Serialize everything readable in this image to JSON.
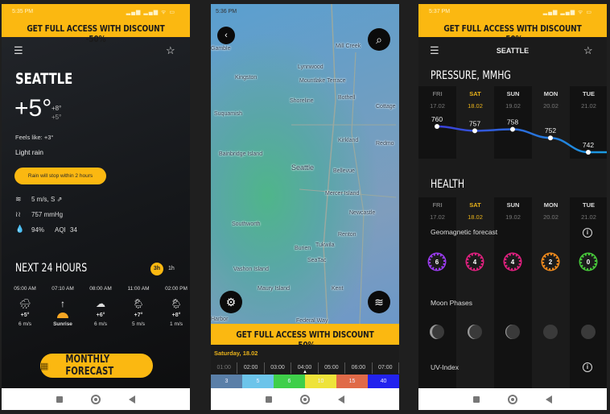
{
  "promo_banner": "GET FULL ACCESS WITH DISCOUNT -50%",
  "screen_main": {
    "status_time": "5:35 PM",
    "status_icons": "▂▄▆ ▂▄▆ ᯤ ▭",
    "city": "SEATTLE",
    "temperature": "+5°",
    "temp_high": "+8°",
    "temp_low": "+5°",
    "feels_like": "Feels like: +3°",
    "condition": "Light rain",
    "rain_notice": "Rain will stop within 2 hours",
    "wind": "5 m/s, S",
    "wind_arrow": "⇗",
    "pressure": "757 mmHg",
    "humidity": "94%",
    "aqi_label": "AQI",
    "aqi_value": "34",
    "next24_title": "NEXT 24 HOURS",
    "toggle_3h": "3h",
    "toggle_1h": "1h",
    "hours": [
      {
        "time": "05:00 AM",
        "icon": "🌧",
        "temp": "+5°",
        "wind": "6 m/s"
      },
      {
        "time": "07:10 AM",
        "icon": "↑",
        "temp": "",
        "wind": "Sunrise"
      },
      {
        "time": "08:00 AM",
        "icon": "☁",
        "temp": "+6°",
        "wind": "6 m/s"
      },
      {
        "time": "11:00 AM",
        "icon": "🌦",
        "temp": "+7°",
        "wind": "5 m/s"
      },
      {
        "time": "02:00 PM",
        "icon": "🌦",
        "temp": "+8°",
        "wind": "1 m/s"
      }
    ],
    "monthly_button": "MONTHLY FORECAST"
  },
  "screen_map": {
    "status_time": "5:36 PM",
    "labels": [
      "Gamble",
      "Mill Creek",
      "Lynnwood",
      "Kingston",
      "Mountlake Terrace",
      "Shoreline",
      "Bothell",
      "Cottage",
      "Suquamish",
      "Kirkland",
      "Redmo",
      "Bainbridge Island",
      "Seattle",
      "Bellevue",
      "Mercer Island",
      "Newcastle",
      "Southworth",
      "Renton",
      "Burien",
      "Tukwila",
      "SeaTac",
      "Vashon Island",
      "Maury Island",
      "Kent",
      "Harbor",
      "Federal Way"
    ],
    "date": "Saturday, 18.02",
    "times": [
      "01:00",
      "02:00",
      "03:00",
      "04:00",
      "05:00",
      "06:00",
      "07:00"
    ],
    "scale": [
      {
        "v": "3",
        "c": "#5a7fa8"
      },
      {
        "v": "5",
        "c": "#6cc4ea"
      },
      {
        "v": "6",
        "c": "#3fcf4a"
      },
      {
        "v": "10",
        "c": "#eee33a"
      },
      {
        "v": "15",
        "c": "#e06a48"
      },
      {
        "v": "40",
        "c": "#2222ee"
      }
    ]
  },
  "screen_details": {
    "status_time": "5:37 PM",
    "city": "SEATTLE",
    "pressure_title": "PRESSURE, MMHG",
    "health_title": "HEALTH",
    "days": [
      {
        "day": "FRI",
        "date": "17.02"
      },
      {
        "day": "SAT",
        "date": "18.02"
      },
      {
        "day": "SUN",
        "date": "19.02"
      },
      {
        "day": "MON",
        "date": "20.02"
      },
      {
        "day": "TUE",
        "date": "21.02"
      }
    ],
    "pressure_values": [
      760,
      757,
      758,
      752,
      742
    ],
    "geomagnetic_label": "Geomagnetic forecast",
    "geomagnetic": [
      {
        "v": "6",
        "c": "#9a3bf0"
      },
      {
        "v": "4",
        "c": "#e0207f"
      },
      {
        "v": "4",
        "c": "#e0207f"
      },
      {
        "v": "2",
        "c": "#f08a1c"
      },
      {
        "v": "0",
        "c": "#47c83a"
      }
    ],
    "moon_label": "Moon Phases",
    "uv_label": "UV-Index"
  },
  "colors": {
    "accent": "#fbb811",
    "line_start": "#3b3fd8",
    "line_end": "#1a9be0"
  }
}
